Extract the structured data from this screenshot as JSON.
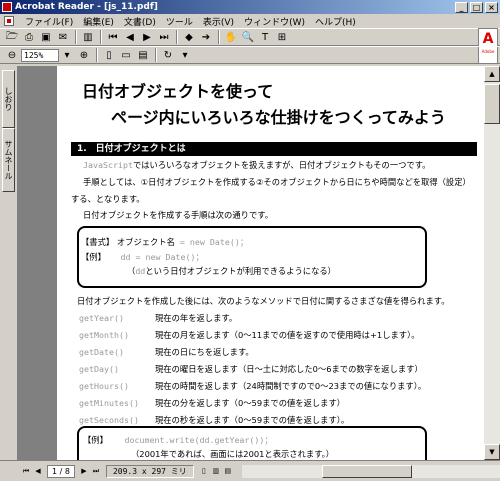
{
  "window": {
    "title": "Acrobat Reader - [js_11.pdf]"
  },
  "menu": [
    "ファイル(F)",
    "編集(E)",
    "文書(D)",
    "ツール",
    "表示(V)",
    "ウィンドウ(W)",
    "ヘルプ(H)"
  ],
  "toolbar": {
    "zoom_value": "125%"
  },
  "logo": {
    "text": "Adobe"
  },
  "side_tabs": {
    "tab1": "しおり",
    "tab2": "サムネール"
  },
  "document": {
    "title_line1": "日付オブジェクトを使って",
    "title_line2": "ページ内にいろいろな仕掛けをつくってみよう",
    "section1": "1.　日付オブジェクトとは",
    "intro_js": "JavaScript",
    "intro_rest": "ではいろいろなオブジェクトを扱えますが、日付オブジェクトもその一つです。",
    "steps_line1": "手順としては、①日付オブジェクトを作成する②そのオブジェクトから日にちや時間などを取得（設定）",
    "steps_line2": "する、となります。",
    "create_line": "日付オブジェクトを作成する手順は次の通りです。",
    "box1": {
      "format_label": "【書式】",
      "format_text": "オブジェクト名",
      "format_code": " = new Date()；",
      "example_label": "【例】",
      "example_code": "dd = new Date()；",
      "example_note_code": "dd",
      "example_note": "という日付オブジェクトが利用できるようになる）"
    },
    "after_line": "日付オブジェクトを作成した後には、次のようなメソッドで日付に関するさまざな値を得られます。",
    "methods": [
      {
        "name": "getYear()",
        "desc": "現在の年を返します。"
      },
      {
        "name": "getMonth()",
        "desc": "現在の月を返します（0～11までの値を返すので使用時は+1します）。"
      },
      {
        "name": "getDate()",
        "desc": "現在の日にちを返します。"
      },
      {
        "name": "getDay()",
        "desc": "現在の曜日を返します（日～土に対応した0～6までの数字を返します）"
      },
      {
        "name": "getHours()",
        "desc": "現在の時間を返します（24時間制ですので0～23までの値になります）。"
      },
      {
        "name": "getMinutes()",
        "desc": "現在の分を返します（0～59までの値を返します）"
      },
      {
        "name": "getSeconds()",
        "desc": "現在の秒を返します（0～59までの値を返します）。"
      }
    ],
    "box2": {
      "example_label": "【例】",
      "example_code": "document.write(dd.getYear())；",
      "example_note": "（2001年であれば、画面には2001と表示されます。）"
    }
  },
  "status": {
    "page": "1 / 8",
    "size": "209.3 x 297 ミリ"
  }
}
